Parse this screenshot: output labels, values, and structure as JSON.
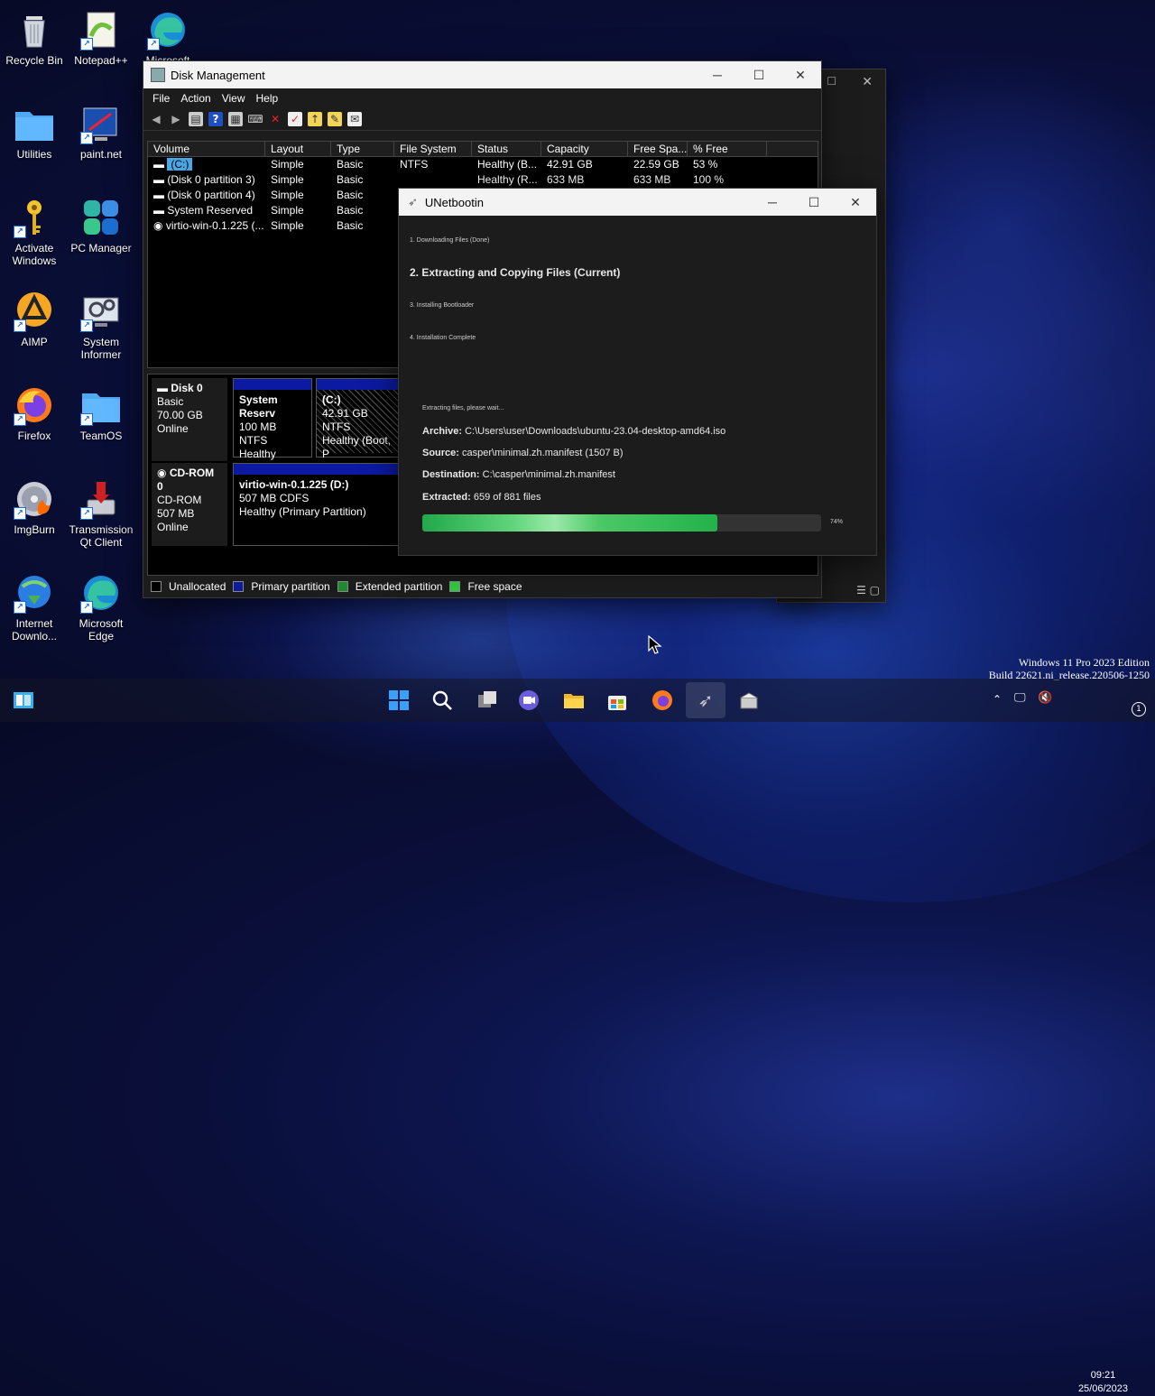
{
  "desktop": {
    "icons": [
      {
        "label": "Recycle Bin"
      },
      {
        "label": "Notepad++"
      },
      {
        "label": "Microsoft"
      },
      {
        "label": "Utilities"
      },
      {
        "label": "paint.net"
      },
      {
        "label": "Activate Windows"
      },
      {
        "label": "PC Manager"
      },
      {
        "label": "AIMP"
      },
      {
        "label": "System Informer"
      },
      {
        "label": "Firefox"
      },
      {
        "label": "TeamOS"
      },
      {
        "label": "ImgBurn"
      },
      {
        "label": "Transmission Qt Client"
      },
      {
        "label": "Internet Downlo..."
      },
      {
        "label": "Microsoft Edge"
      }
    ]
  },
  "disk_management": {
    "title": "Disk Management",
    "menu": [
      "File",
      "Action",
      "View",
      "Help"
    ],
    "columns": [
      "Volume",
      "Layout",
      "Type",
      "File System",
      "Status",
      "Capacity",
      "Free Spa...",
      "% Free"
    ],
    "rows": [
      {
        "volume": "(C:)",
        "layout": "Simple",
        "type": "Basic",
        "fs": "NTFS",
        "status": "Healthy (B...",
        "capacity": "42.91 GB",
        "free": "22.59 GB",
        "pct": "53 %"
      },
      {
        "volume": "(Disk 0 partition 3)",
        "layout": "Simple",
        "type": "Basic",
        "fs": "",
        "status": "Healthy (R...",
        "capacity": "633 MB",
        "free": "633 MB",
        "pct": "100 %"
      },
      {
        "volume": "(Disk 0 partition 4)",
        "layout": "Simple",
        "type": "Basic",
        "fs": "",
        "status": "",
        "capacity": "",
        "free": "",
        "pct": ""
      },
      {
        "volume": "System Reserved",
        "layout": "Simple",
        "type": "Basic",
        "fs": "",
        "status": "",
        "capacity": "",
        "free": "",
        "pct": ""
      },
      {
        "volume": "virtio-win-0.1.225 (...",
        "layout": "Simple",
        "type": "Basic",
        "fs": "",
        "status": "",
        "capacity": "",
        "free": "",
        "pct": ""
      }
    ],
    "disk0": {
      "name": "Disk 0",
      "type": "Basic",
      "size": "70.00 GB",
      "state": "Online"
    },
    "disk0_parts": [
      {
        "name": "System Reserv",
        "size": "100 MB NTFS",
        "status": "Healthy (Syste"
      },
      {
        "name": "(C:)",
        "size": "42.91 GB NTFS",
        "status": "Healthy (Boot, P"
      }
    ],
    "cdrom": {
      "name": "CD-ROM 0",
      "type": "CD-ROM",
      "size": "507 MB",
      "state": "Online"
    },
    "cdrom_part": {
      "name": "virtio-win-0.1.225  (D:)",
      "size": "507 MB CDFS",
      "status": "Healthy (Primary Partition)"
    },
    "legend": [
      "Unallocated",
      "Primary partition",
      "Extended partition",
      "Free space"
    ],
    "colors": {
      "unallocated": "#000000",
      "primary": "#0b1aa0",
      "extended": "#1e8a2e",
      "free": "#2ecc40"
    }
  },
  "unetbootin": {
    "title": "UNetbootin",
    "step1": "1. Downloading Files (Done)",
    "step2": "2. Extracting and Copying Files (Current)",
    "step3": "3. Installing Bootloader",
    "step4": "4. Installation Complete",
    "status": "Extracting files, please wait...",
    "archive_label": "Archive:",
    "archive_value": "C:\\Users\\user\\Downloads\\ubuntu-23.04-desktop-amd64.iso",
    "source_label": "Source:",
    "source_value": "casper\\minimal.zh.manifest (1507 B)",
    "dest_label": "Destination:",
    "dest_value": "C:\\casper\\minimal.zh.manifest",
    "extracted_label": "Extracted:",
    "extracted_value": "659 of 881 files",
    "progress": 74,
    "progress_text": "74%"
  },
  "taskbar": {
    "time": "09:21",
    "date": "25/06/2023",
    "notifications": "1"
  },
  "watermark": {
    "line1": "Windows 11 Pro 2023 Edition",
    "line2": "Build 22621.ni_release.220506-1250"
  }
}
